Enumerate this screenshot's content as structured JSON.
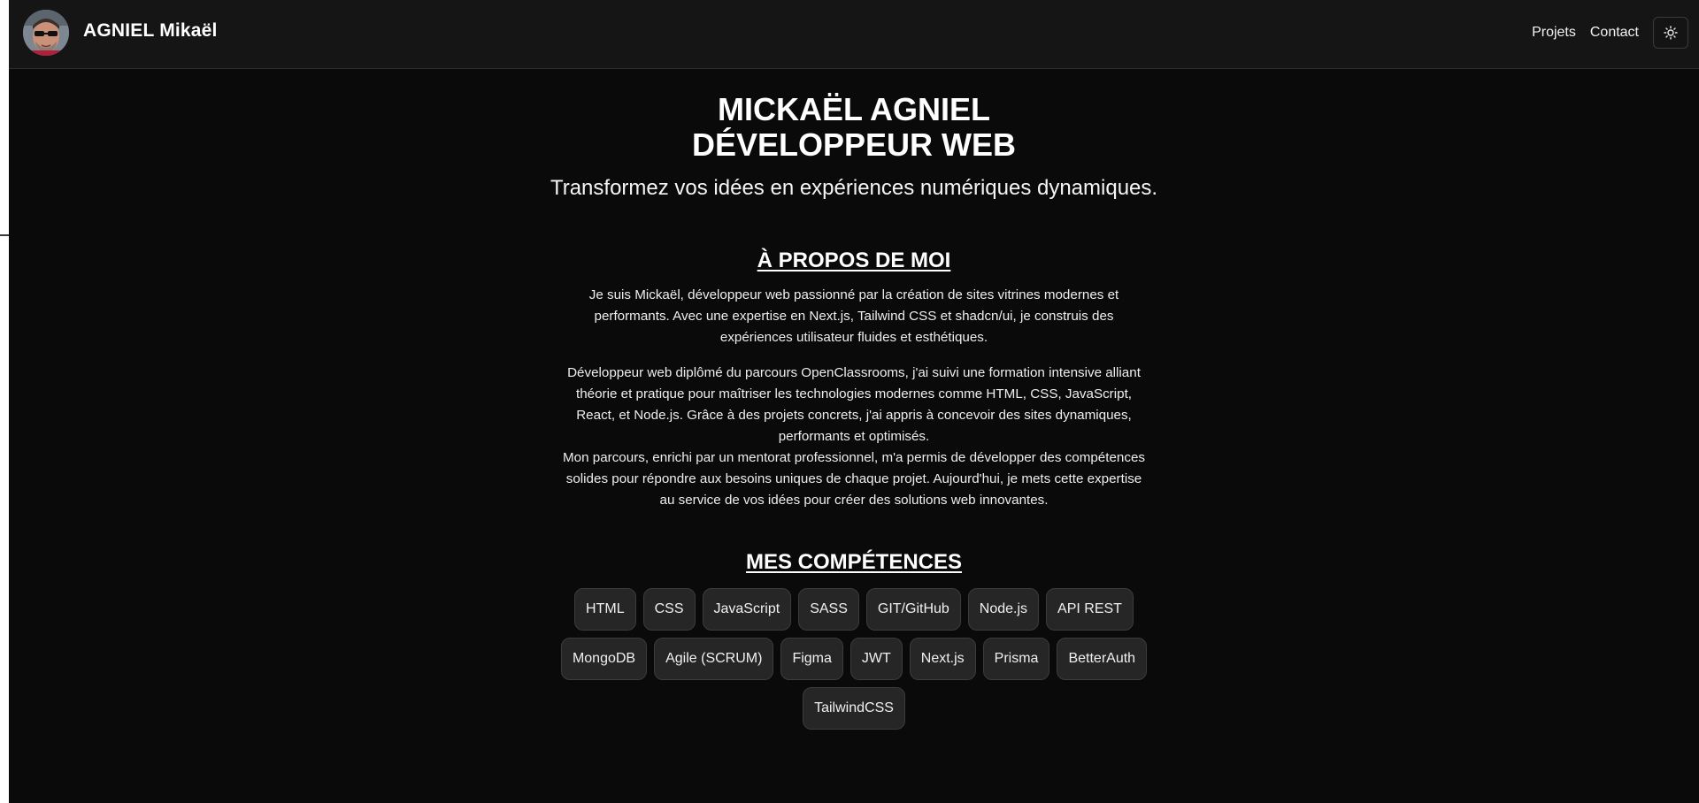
{
  "navbar": {
    "brand": "AGNIEL Mikaël",
    "links": [
      {
        "label": "Projets"
      },
      {
        "label": "Contact"
      }
    ],
    "theme_toggle_icon": "sun-icon"
  },
  "hero": {
    "title_line1": "MICKAËL AGNIEL",
    "title_line2": "DÉVELOPPEUR WEB",
    "tagline": "Transformez vos idées en expériences numériques dynamiques."
  },
  "about": {
    "title": "À PROPOS DE MOI",
    "paragraph1": "Je suis Mickaël, développeur web passionné par la création de sites vitrines modernes et performants. Avec une expertise en Next.js, Tailwind CSS et shadcn/ui, je construis des expériences utilisateur fluides et esthétiques.",
    "paragraph2a": "Développeur web diplômé du parcours OpenClassrooms, j'ai suivi une formation intensive alliant théorie et pratique pour maîtriser les technologies modernes comme HTML, CSS, JavaScript, React, et Node.js. Grâce à des projets concrets, j'ai appris à concevoir des sites dynamiques, performants et optimisés.",
    "paragraph2b": "Mon parcours, enrichi par un mentorat professionnel, m'a permis de développer des compétences solides pour répondre aux besoins uniques de chaque projet. Aujourd'hui, je mets cette expertise au service de vos idées pour créer des solutions web innovantes."
  },
  "skills": {
    "title": "MES COMPÉTENCES",
    "items": [
      "HTML",
      "CSS",
      "JavaScript",
      "SASS",
      "GIT/GitHub",
      "Node.js",
      "API REST",
      "MongoDB",
      "Agile (SCRUM)",
      "Figma",
      "JWT",
      "Next.js",
      "Prisma",
      "BetterAuth",
      "TailwindCSS"
    ]
  },
  "colors": {
    "background": "#0a0a0a",
    "navbar": "#151515",
    "chip_background": "#262626",
    "chip_border": "#3c3c3c",
    "text": "#ffffff"
  }
}
